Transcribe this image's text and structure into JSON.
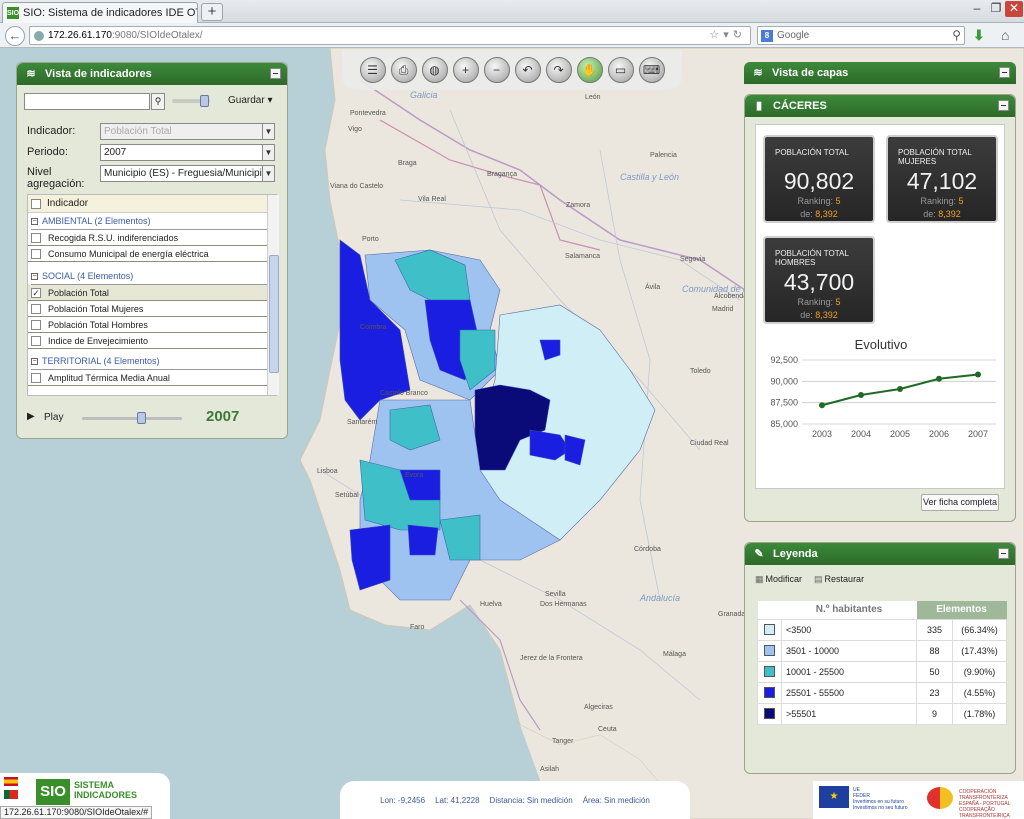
{
  "browser": {
    "tab_title": "SIO: Sistema de indicadores IDE OTALEX",
    "tab_favicon": "SIO",
    "url_host": "172.26.61.170",
    "url_path": ":9080/SIOIdeOtalex/",
    "search_placeholder": "Google",
    "status_url": "172.26.61.170:9080/SIOIdeOtalex/#"
  },
  "toolbar": {
    "tools": [
      "layers-icon",
      "print-icon",
      "globe-icon",
      "zoom-in-icon",
      "zoom-out-icon",
      "undo-icon",
      "redo-icon",
      "pan-hand-icon",
      "measure-icon",
      "keyboard-icon"
    ]
  },
  "indicators_panel": {
    "title": "Vista de indicadores",
    "search_value": "",
    "save_label": "Guardar",
    "indicator_label": "Indicador:",
    "indicator_value": "Población Total",
    "period_label": "Periodo:",
    "period_value": "2007",
    "level_label_1": "Nivel",
    "level_label_2": "agregación:",
    "level_value": "Municipio (ES) - Freguesia/Municipio",
    "list_header": "Indicador",
    "groups": [
      {
        "name": "AMBIENTAL (2 Elementos)",
        "items": [
          {
            "label": "Recogida R.S.U. indiferenciados",
            "checked": false
          },
          {
            "label": "Consumo Municipal de energía eléctrica",
            "checked": false
          }
        ]
      },
      {
        "name": "SOCIAL (4 Elementos)",
        "items": [
          {
            "label": "Población Total",
            "checked": true
          },
          {
            "label": "Población Total Mujeres",
            "checked": false
          },
          {
            "label": "Población Total Hombres",
            "checked": false
          },
          {
            "label": "Indice de Envejecimiento",
            "checked": false
          }
        ]
      },
      {
        "name": "TERRITORIAL (4 Elementos)",
        "items": [
          {
            "label": "Amplitud Térmica Media Anual",
            "checked": false
          }
        ]
      }
    ],
    "play_label": "Play",
    "play_year": "2007"
  },
  "layers_panel": {
    "title": "Vista de capas"
  },
  "caceres_panel": {
    "title": "CÁCERES",
    "stats": [
      {
        "title": "POBLACIÓN TOTAL",
        "value": "90,802",
        "ranking_label": "Ranking:",
        "ranking": "5",
        "of_label": "de:",
        "of": "8,392"
      },
      {
        "title": "POBLACIÓN TOTAL MUJERES",
        "value": "47,102",
        "ranking_label": "Ranking:",
        "ranking": "5",
        "of_label": "de:",
        "of": "8,392"
      },
      {
        "title": "POBLACIÓN TOTAL HOMBRES",
        "value": "43,700",
        "ranking_label": "Ranking:",
        "ranking": "5",
        "of_label": "de:",
        "of": "8,392"
      }
    ],
    "chart_title": "Evolutivo",
    "button": "Ver ficha completa"
  },
  "chart_data": {
    "type": "line",
    "title": "Evolutivo",
    "categories": [
      "2003",
      "2004",
      "2005",
      "2006",
      "2007"
    ],
    "values": [
      87200,
      88400,
      89100,
      90300,
      90802
    ],
    "ylim": [
      85000,
      92500
    ],
    "yticks": [
      "92,500",
      "90,000",
      "87,500",
      "85,000"
    ],
    "yticks_values": [
      92500,
      90000,
      87500,
      85000
    ],
    "grid": true,
    "color": "#1e6a22"
  },
  "legend_panel": {
    "title": "Leyenda",
    "modify_label": "Modificar",
    "restore_label": "Restaurar",
    "col_habitantes": "N.º habitantes",
    "col_elementos": "Elementos",
    "rows": [
      {
        "color": "#cfeef6",
        "range": "<3500",
        "count": "335",
        "pct": "(66.34%)"
      },
      {
        "color": "#9fc3f0",
        "range": "3501 - 10000",
        "count": "88",
        "pct": "(17.43%)"
      },
      {
        "color": "#3fc0c8",
        "range": "10001 - 25500",
        "count": "50",
        "pct": "(9.90%)"
      },
      {
        "color": "#1a1ee0",
        "range": "25501 - 55500",
        "count": "23",
        "pct": "(4.55%)"
      },
      {
        "color": "#0a0a78",
        "range": ">55501",
        "count": "9",
        "pct": "(1.78%)"
      }
    ]
  },
  "map": {
    "cities": [
      "Galicia",
      "Pontevedra",
      "Vigo",
      "Braga",
      "Viana do Castelo",
      "Bragança",
      "Vila Real",
      "Porto",
      "Zamora",
      "León",
      "Palencia",
      "Castilla y León",
      "Salamanca",
      "Ávila",
      "Segovia",
      "Madrid",
      "Comunidad de Madrid",
      "Alcobendas",
      "Toledo",
      "Ciudad Real",
      "Coimbra",
      "Castelo Branco",
      "Santarém",
      "Lisboa",
      "Setúbal",
      "Évora",
      "Faro",
      "Huelva",
      "Sevilla",
      "Dos Hermanas",
      "Andalucía",
      "Córdoba",
      "Granada",
      "Jerez de la Frontera",
      "Málaga",
      "Algeciras",
      "Tanger",
      "Ceuta",
      "Asilah"
    ],
    "coords_lon": "Lon: -9,2456",
    "coords_lat": "Lat: 41,2228",
    "coords_dist": "Distancia: Sin medición",
    "coords_area": "Área: Sin medición"
  },
  "footer": {
    "sio_logo": "SIO",
    "sio_text_1": "SISTEMA",
    "sio_text_2": "INDICADORES",
    "eu_text_1": "UE",
    "eu_text_2": "FEDER",
    "eu_text_3": "Invertimos en su futuro",
    "eu_text_4": "Investimos no seu futuro",
    "poctep_text_1": "COOPERACIÓN TRANSFRONTERIZA",
    "poctep_text_2": "ESPAÑA - PORTUGAL",
    "poctep_text_3": "COOPERAÇÃO TRANSFRONTEIRIÇA"
  }
}
